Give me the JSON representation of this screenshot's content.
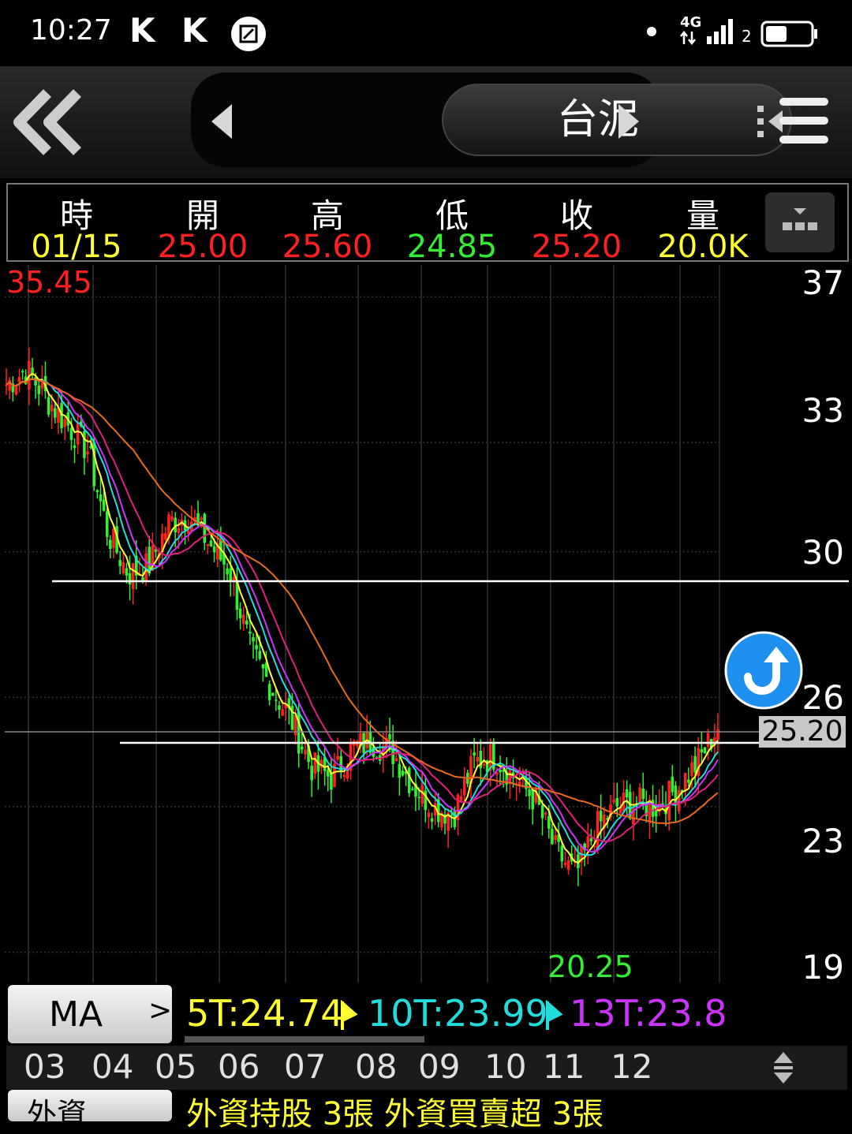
{
  "status_bar": {
    "time": "10:27",
    "app_icon_1": "K",
    "app_icon_2": "K",
    "net": "4G",
    "sim": "2"
  },
  "header": {
    "stock_name": "台泥"
  },
  "quote": {
    "headers": [
      "時",
      "開",
      "高",
      "低",
      "收",
      "量"
    ],
    "values": [
      "01/15",
      "25.00",
      "25.60",
      "24.85",
      "25.20",
      "20.0K"
    ],
    "colors": [
      "#ffff33",
      "#ff2020",
      "#ff2020",
      "#33ee33",
      "#ff2020",
      "#ffff33"
    ]
  },
  "chart": {
    "high_label": "35.45",
    "low_label": "20.25",
    "current_price": "25.20",
    "y_labels": [
      "37",
      "33",
      "30",
      "26",
      "23",
      "19"
    ]
  },
  "ma_bar": {
    "button_label": "MA",
    "button_chevron": ">",
    "ma5": "5T:24.74",
    "ma10": "10T:23.99",
    "ma13": "13T:23.8"
  },
  "months": [
    "03",
    "04",
    "05",
    "06",
    "07",
    "08",
    "09",
    "10",
    "11",
    "12"
  ],
  "bottom_partial": {
    "button_label": "外資",
    "text": "外資持股 3張 外資買賣超 3張"
  },
  "colors": {
    "up": "#ff2020",
    "down": "#33ee33",
    "ma5": "#ffff33",
    "ma10": "#22dddd",
    "ma13": "#cc33ff"
  },
  "chart_data": {
    "type": "candlestick",
    "y_axis_ticks": [
      37,
      33,
      30,
      26,
      23,
      19
    ],
    "x_axis_months": [
      "03",
      "04",
      "05",
      "06",
      "07",
      "08",
      "09",
      "10",
      "11",
      "12"
    ],
    "high": 35.45,
    "low": 20.25,
    "last_close": 25.2,
    "ma_lines": [
      {
        "name": "5T",
        "value": 24.74,
        "color": "#ffff33"
      },
      {
        "name": "10T",
        "value": 23.99,
        "color": "#22dddd"
      },
      {
        "name": "13T",
        "value": 23.8,
        "color": "#cc33ff"
      }
    ],
    "close_series": [
      34.6,
      35.0,
      34.2,
      33.5,
      32.8,
      30.5,
      29.4,
      29.6,
      30.8,
      31.0,
      30.2,
      29.5,
      27.3,
      26.3,
      25.4,
      24.1,
      23.8,
      24.6,
      24.8,
      24.5,
      23.6,
      23.0,
      22.8,
      24.2,
      24.4,
      23.8,
      23.2,
      21.8,
      21.1,
      22.4,
      23.0,
      23.1,
      23.0,
      23.5,
      24.2,
      25.2
    ],
    "horizontal_lines": [
      29.6,
      25.0
    ]
  }
}
